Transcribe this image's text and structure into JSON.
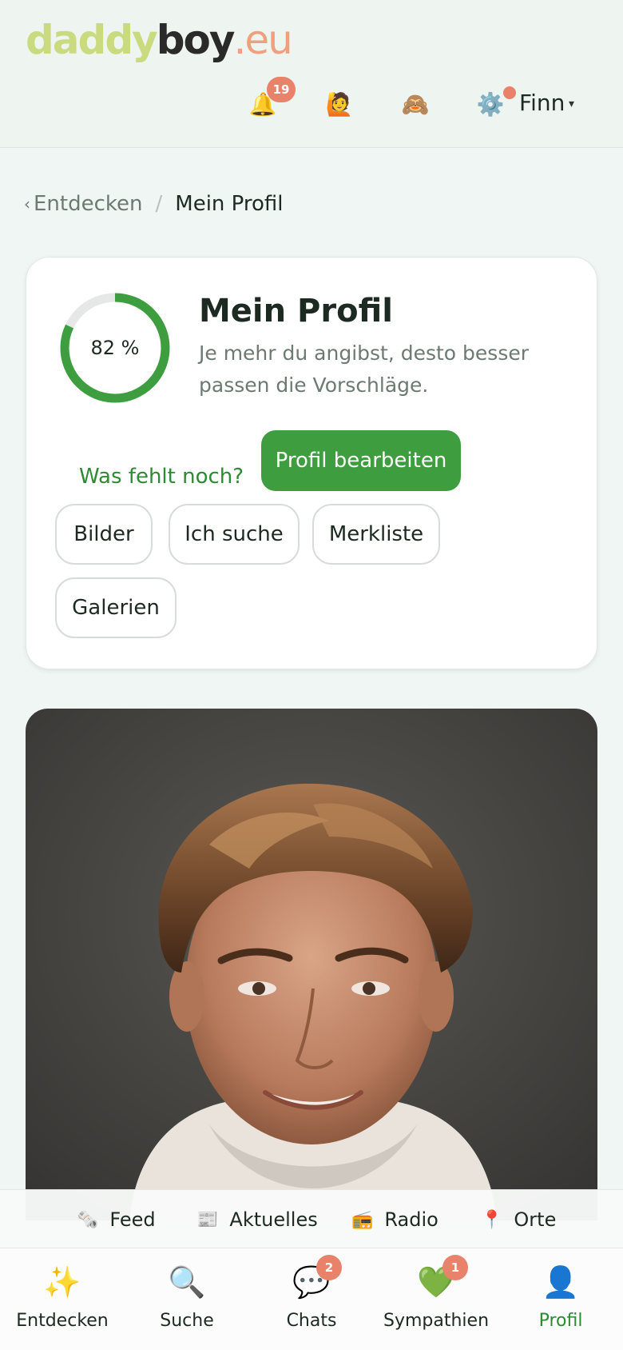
{
  "brand": {
    "logo_part1": "daddy",
    "logo_part2": "boy",
    "logo_part3": ".eu",
    "colors": {
      "accent_green": "#3e9d3e",
      "badge": "#e9826a",
      "logo_lime": "#c9da7f",
      "logo_peach": "#f0a07c"
    }
  },
  "header": {
    "notifications": {
      "icon": "bell-icon",
      "glyph": "🔔",
      "count": "19"
    },
    "visitors": {
      "icon": "person-raising-hand-icon",
      "glyph": "🙋"
    },
    "incognito": {
      "icon": "see-no-evil-monkey-icon",
      "glyph": "🙈"
    },
    "settings": {
      "icon": "gear-icon",
      "glyph": "⚙️",
      "has_dot": true
    },
    "user_name": "Finn",
    "caret": "▾"
  },
  "breadcrumb": {
    "chevron": "‹",
    "parent": "Entdecken",
    "separator": "/",
    "current": "Mein Profil"
  },
  "profile_card": {
    "completion_label": "82 %",
    "completion_fraction": 0.82,
    "title": "Mein Profil",
    "subtitle": "Je mehr du angibst, desto besser passen die Vorschläge.",
    "missing_link": "Was fehlt noch?",
    "edit_button": "Profil bearbeiten",
    "chips": [
      "Bilder",
      "Ich suche",
      "Merkliste",
      "Galerien"
    ]
  },
  "subnav": {
    "items": [
      {
        "label": "Feed",
        "glyph": "🗞️",
        "icon": "newspaper-roll-icon"
      },
      {
        "label": "Aktuelles",
        "glyph": "📰",
        "icon": "newspaper-icon"
      },
      {
        "label": "Radio",
        "glyph": "📻",
        "icon": "radio-icon"
      },
      {
        "label": "Orte",
        "glyph": "📍",
        "icon": "pin-icon"
      }
    ]
  },
  "bottomnav": {
    "items": [
      {
        "label": "Entdecken",
        "glyph": "✨",
        "icon": "sparkles-icon",
        "badge": ""
      },
      {
        "label": "Suche",
        "glyph": "🔍",
        "icon": "magnifier-icon",
        "badge": ""
      },
      {
        "label": "Chats",
        "glyph": "💬",
        "icon": "speech-bubble-icon",
        "badge": "2"
      },
      {
        "label": "Sympathien",
        "glyph": "💚",
        "icon": "green-heart-icon",
        "badge": "1"
      },
      {
        "label": "Profil",
        "glyph": "👤",
        "icon": "person-silhouette-icon",
        "badge": "",
        "active": true
      }
    ]
  }
}
